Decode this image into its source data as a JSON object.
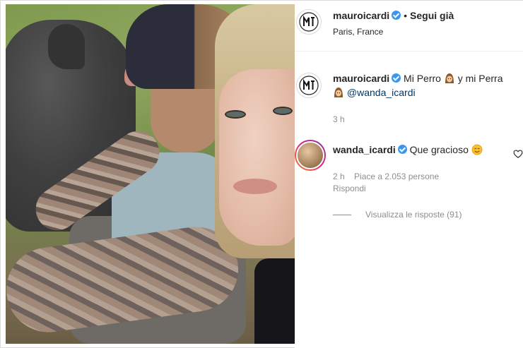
{
  "post": {
    "author": "mauroicardi",
    "follow_label": "Segui già",
    "separator": "•",
    "location": "Paris, France"
  },
  "caption": {
    "author": "mauroicardi",
    "text_part1": "Mi Perro",
    "text_part2": "y mi Perra",
    "mention": "@wanda_icardi",
    "time": "3 h"
  },
  "comment": {
    "author": "wanda_icardi",
    "text": "Que gracioso",
    "time": "2 h",
    "likes": "Piace a 2.053 persone",
    "reply_label": "Rispondi",
    "view_replies": "Visualizza le risposte (91)"
  },
  "icons": {
    "verified": "verified-badge-icon",
    "heart": "heart-outline-icon",
    "emoji_girl": "girl-emoji-icon",
    "emoji_smile": "smiling-face-emoji-icon"
  },
  "colors": {
    "verified": "#3897f0",
    "mention": "#00376b",
    "secondary_text": "#8e8e8e"
  }
}
